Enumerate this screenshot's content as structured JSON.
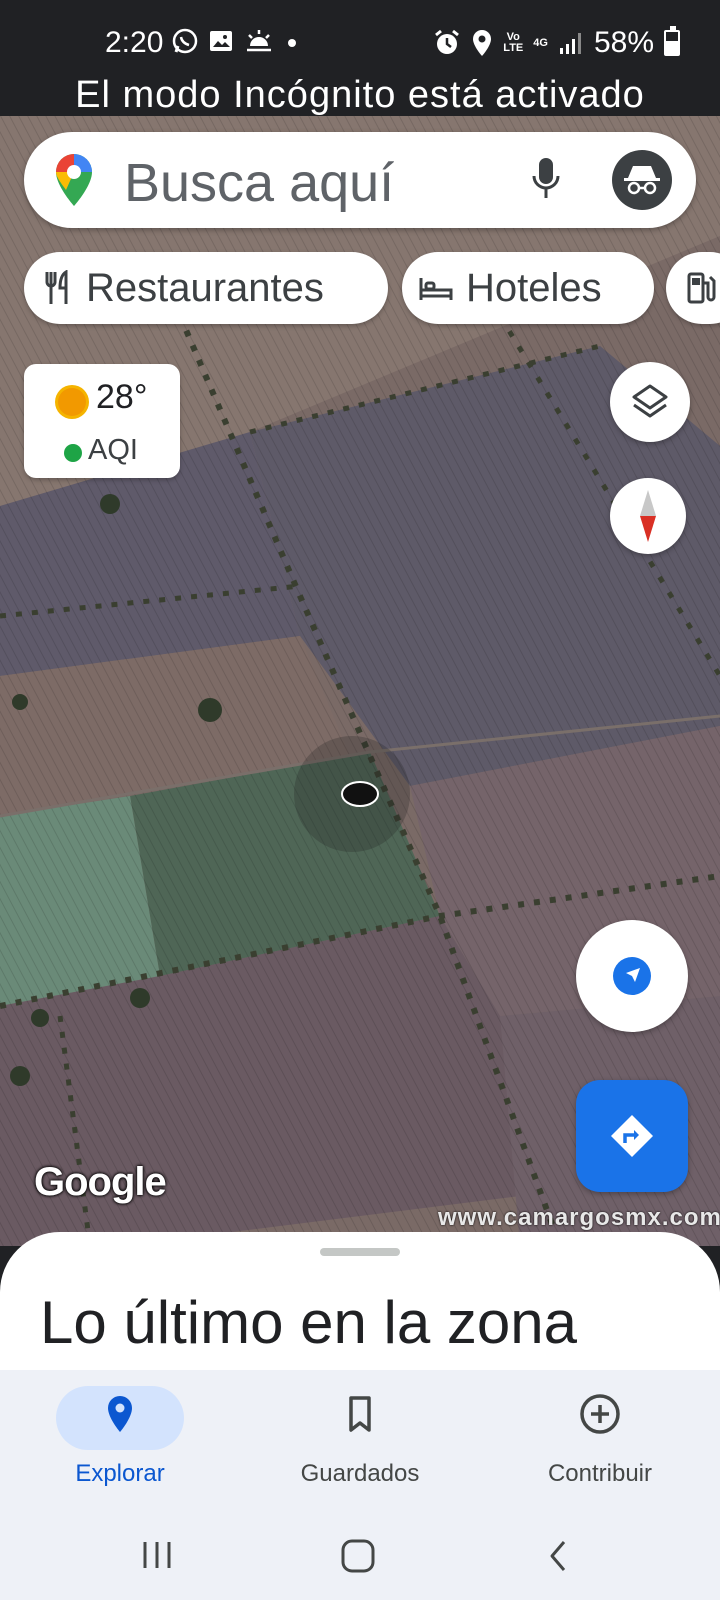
{
  "status_bar": {
    "time": "2:20",
    "left_icons": [
      "whatsapp-icon",
      "gallery-icon",
      "weather-icon",
      "dot-icon"
    ],
    "volte": "Vo\nLTE",
    "network": "4G",
    "battery": "58%",
    "battery_level": 0.58
  },
  "banner": {
    "text": "El modo Incógnito está activado"
  },
  "search": {
    "placeholder": "Busca aquí"
  },
  "chips": [
    {
      "label": "Restaurantes",
      "icon": "restaurant-icon"
    },
    {
      "label": "Hoteles",
      "icon": "hotel-icon"
    },
    {
      "label": "",
      "icon": "gas-station-icon"
    }
  ],
  "weather": {
    "temp": "28°",
    "aqi": "AQI"
  },
  "map": {
    "attribution": "Google",
    "watermark": "www.camargosmx.com"
  },
  "sheet": {
    "title": "Lo último en la zona"
  },
  "nav": {
    "items": [
      {
        "label": "Explorar",
        "icon": "location-pin-icon",
        "active": true
      },
      {
        "label": "Guardados",
        "icon": "bookmark-icon",
        "active": false
      },
      {
        "label": "Contribuir",
        "icon": "add-circle-icon",
        "active": false
      }
    ]
  },
  "colors": {
    "accent": "#1a73e8",
    "active_pill": "#d3e3fd",
    "active_text": "#0b57d0"
  }
}
